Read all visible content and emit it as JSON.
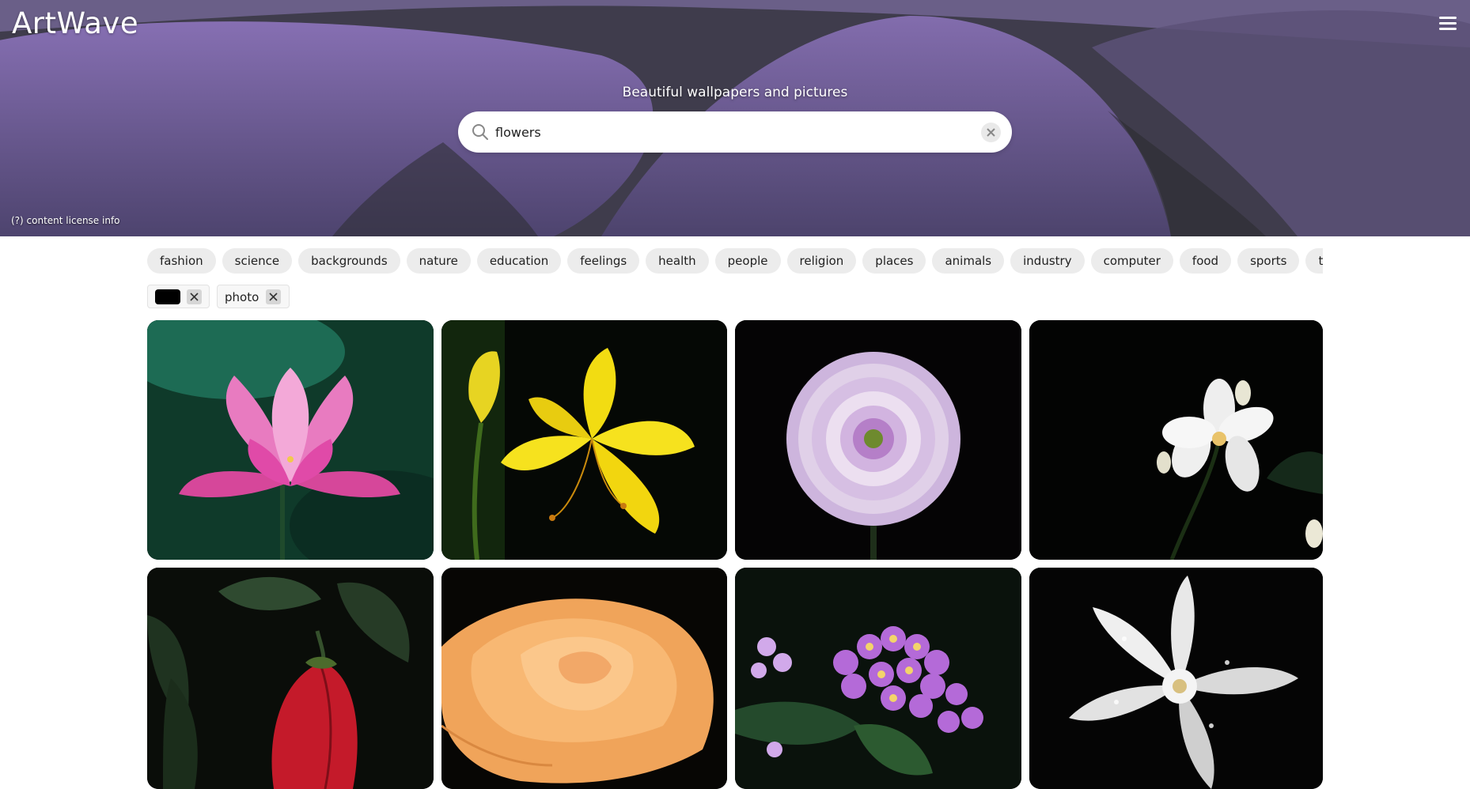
{
  "header": {
    "logo": "ArtWave",
    "menu_icon": "hamburger-menu-icon",
    "tagline": "Beautiful wallpapers and pictures",
    "license_link": "(?) content license info"
  },
  "search": {
    "value": "flowers",
    "placeholder": "",
    "search_icon": "search-icon",
    "clear_icon": "close-icon"
  },
  "categories": [
    "fashion",
    "science",
    "backgrounds",
    "nature",
    "education",
    "feelings",
    "health",
    "people",
    "religion",
    "places",
    "animals",
    "industry",
    "computer",
    "food",
    "sports",
    "transportation"
  ],
  "filters": {
    "color": {
      "value": "#000000",
      "remove_icon": "close-icon"
    },
    "type": {
      "label": "photo",
      "remove_icon": "close-icon"
    }
  },
  "results": [
    {
      "subject": "pink lotus flower",
      "icon": "lotus-image"
    },
    {
      "subject": "yellow lily flower",
      "icon": "lily-image"
    },
    {
      "subject": "lilac dahlia flower",
      "icon": "dahlia-image"
    },
    {
      "subject": "white jasmine flower",
      "icon": "jasmine-image"
    },
    {
      "subject": "red hibiscus bud",
      "icon": "hibiscus-image"
    },
    {
      "subject": "orange rose",
      "icon": "rose-image"
    },
    {
      "subject": "purple lantana cluster",
      "icon": "lantana-image"
    },
    {
      "subject": "white daffodil with dew drops",
      "icon": "daffodil-image"
    }
  ],
  "colors": {
    "chip_bg": "#ececec",
    "hero_tint": "#6c6386",
    "lotus": "#e04aa8",
    "lily": "#f2dc12",
    "dahlia": "#c7a3da",
    "rose": "#f6a45c",
    "hibiscus": "#c41a2a",
    "lantana": "#b46ad8"
  }
}
